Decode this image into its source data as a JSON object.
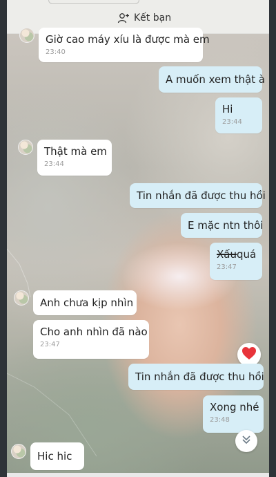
{
  "header": {
    "add_friend_label": "Kết bạn",
    "icon": "add-person-icon"
  },
  "messages": [
    {
      "id": "m1",
      "side": "in",
      "text": "Giờ cao máy xíu là được mà em",
      "time": "23:40"
    },
    {
      "id": "m2",
      "side": "out",
      "text": "A muốn xem thật à",
      "time": ""
    },
    {
      "id": "m3",
      "side": "out",
      "text": "Hi",
      "time": "23:44"
    },
    {
      "id": "m4",
      "side": "in",
      "text": "Thật mà em",
      "time": "23:44"
    },
    {
      "id": "m5",
      "side": "out",
      "text": "Tin nhắn đã được thu hồi",
      "time": ""
    },
    {
      "id": "m6",
      "side": "out",
      "text": "E mặc ntn thôi",
      "time": ""
    },
    {
      "id": "m7",
      "side": "out",
      "struck": "Xấu",
      "text": "quá",
      "time": "23:47"
    },
    {
      "id": "m8",
      "side": "in",
      "text": "Anh chưa kịp nhìn",
      "time": ""
    },
    {
      "id": "m9",
      "side": "in",
      "text": "Cho anh nhìn đã nào",
      "time": "23:47"
    },
    {
      "id": "m10",
      "side": "out",
      "text": "Tin nhắn đã được thu hồi",
      "time": ""
    },
    {
      "id": "m11",
      "side": "out",
      "text": "Xong nhé",
      "time": "23:48"
    },
    {
      "id": "m12",
      "side": "in",
      "text": "Hic hic",
      "time": ""
    }
  ],
  "reaction_icon": "heart-icon",
  "scroll_icon": "double-chevron-down-icon",
  "colors": {
    "incoming_bubble": "#ffffff",
    "outgoing_bubble": "#d7eef7",
    "heart": "#e8333a"
  }
}
